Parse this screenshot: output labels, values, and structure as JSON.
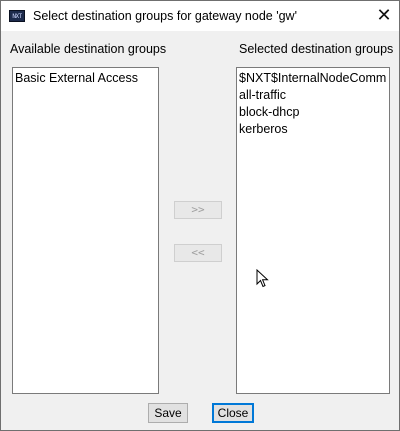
{
  "window": {
    "title": "Select destination groups for gateway node 'gw'",
    "app_icon_text": "NXT",
    "close_symbol": "✕"
  },
  "available": {
    "label": "Available destination groups",
    "items": [
      "Basic External Access"
    ]
  },
  "selected": {
    "label": "Selected destination groups",
    "items": [
      "$NXT$InternalNodeComm",
      "all-traffic",
      "block-dhcp",
      "kerberos"
    ]
  },
  "buttons": {
    "add": ">>",
    "remove": "<<",
    "save": "Save",
    "close": "Close"
  },
  "icons": {
    "app": "nxt-app-icon",
    "close": "close-icon",
    "cursor": "mouse-cursor-icon"
  }
}
